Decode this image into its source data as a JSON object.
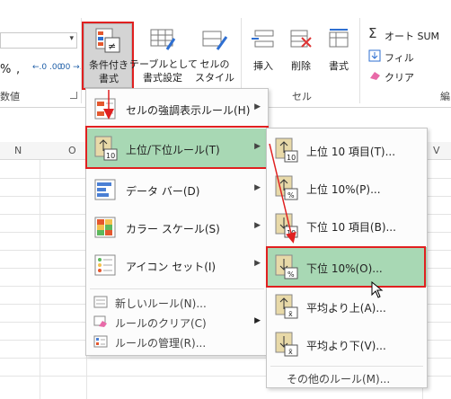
{
  "ribbon": {
    "conditional_format_line1": "条件付き",
    "conditional_format_line2": "書式",
    "table_format_line1": "テーブルとして",
    "table_format_line2": "書式設定",
    "cell_style_line1": "セルの",
    "cell_style_line2": "スタイル",
    "insert": "挿入",
    "delete": "削除",
    "format": "書式",
    "autosum": "オート SUM",
    "fill": "フィル",
    "clear": "クリア",
    "group_number": "数値",
    "group_cells": "セル",
    "group_edit_partial": "編",
    "percent_symbol": "%",
    "comma_symbol": ",",
    "dec_inc": "←.0 .00",
    "dec_dec": ".00 →.0",
    "sigma": "Σ",
    "dropdown_arrow": "▾"
  },
  "columns": [
    "N",
    "O",
    "V"
  ],
  "menu": {
    "items": [
      {
        "label": "セルの強調表示ルール(H)"
      },
      {
        "label": "上位/下位ルール(T)"
      },
      {
        "label": "データ バー(D)"
      },
      {
        "label": "カラー スケール(S)"
      },
      {
        "label": "アイコン セット(I)"
      }
    ],
    "small_items": [
      {
        "label": "新しいルール(N)..."
      },
      {
        "label": "ルールのクリア(C)"
      },
      {
        "label": "ルールの管理(R)..."
      }
    ],
    "submenu_arrow": "▶"
  },
  "submenu": {
    "items": [
      {
        "label": "上位 10 項目(T)...",
        "icon_tag": "10"
      },
      {
        "label": "上位 10%(P)...",
        "icon_tag": "%"
      },
      {
        "label": "下位 10 項目(B)...",
        "icon_tag": "10"
      },
      {
        "label": "下位 10%(O)...",
        "icon_tag": "%"
      },
      {
        "label": "平均より上(A)...",
        "icon_tag": "x̄"
      },
      {
        "label": "平均より下(V)...",
        "icon_tag": "x̄"
      }
    ],
    "more": "その他のルール(M)..."
  },
  "colors": {
    "highlight": "#a8d8b4",
    "annotation_red": "#e02020"
  }
}
